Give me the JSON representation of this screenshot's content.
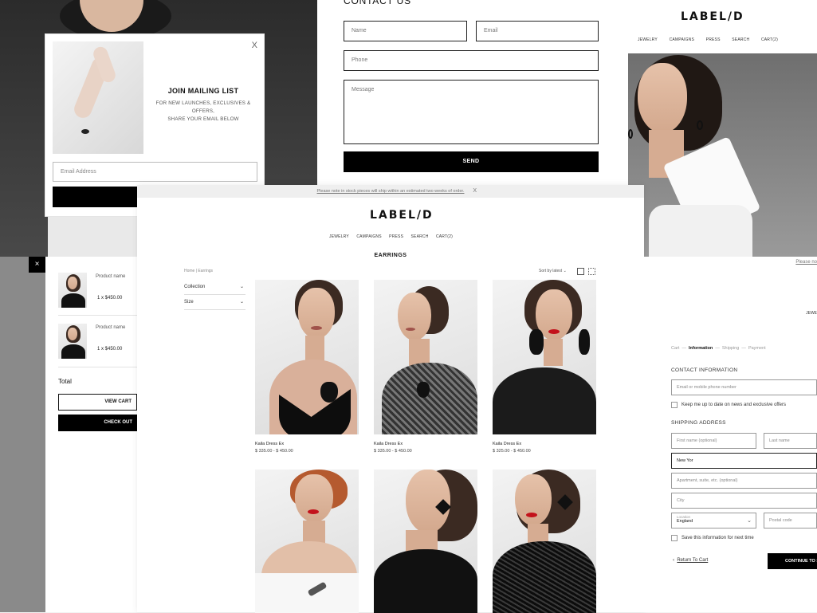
{
  "mailing": {
    "close": "X",
    "title": "JOIN MAILING LIST",
    "line1": "FOR NEW LAUNCHES, EXCLUSIVES & OFFERS,",
    "line2": "SHARE YOUR EMAIL BELOW",
    "email_placeholder": "Email Address"
  },
  "contact": {
    "title": "CONTACT US",
    "name": "Name",
    "email": "Email",
    "phone": "Phone",
    "message": "Message",
    "send": "SEND"
  },
  "brand": "LABEL/D",
  "nav": [
    "JEWELRY",
    "CAMPAIGNS",
    "PRESS",
    "SEARCH",
    "CART(2)"
  ],
  "cart": {
    "close": "×",
    "items": [
      {
        "name": "Product name",
        "price": "1 x $450.00"
      },
      {
        "name": "Product name",
        "price": "1 x $450.00"
      }
    ],
    "total": "Total",
    "view_cart": "VIEW CART",
    "check_out": "CHECK OUT"
  },
  "store": {
    "notice": "Please note in stock pieces will ship within an estimated two weeks of order.",
    "notice_close": "X",
    "page_title": "EARRINGS",
    "breadcrumb": "Home  |  Earrings",
    "filters": [
      "Collection",
      "Size"
    ],
    "sort": "Sort by latest  ⌄",
    "products": [
      {
        "name": "Kaila Dress Ex",
        "price": "$ 335.00 - $ 450.00"
      },
      {
        "name": "Kaila Dress Ex",
        "price": "$ 335.00 - $ 450.00"
      },
      {
        "name": "Kaila Dress Ex",
        "price": "$ 325.00 - $ 450.00"
      }
    ]
  },
  "checkout": {
    "top_note": "Please no",
    "jewelry": "JEWE",
    "steps": {
      "cart": "Cart",
      "information": "Information",
      "shipping": "Shipping",
      "payment": "Payment"
    },
    "contact_title": "CONTACT INFORMATION",
    "contact_placeholder": "Email or mobile phone number",
    "newsletter_label": "Keep me up to date on news and exclusive offers",
    "shipping_title": "SHIPPING ADDRESS",
    "first_name": "First name (optional)",
    "last_name": "Last name",
    "address_value": "New Yor",
    "apartment": "Apartment, suite, etc. (optional)",
    "city": "City",
    "location_label": "Location",
    "location_value": "England",
    "postal": "Postal code",
    "save_label": "Save this information for next time",
    "return": "Return To Cart",
    "continue": "CONTINUE TO SH"
  }
}
